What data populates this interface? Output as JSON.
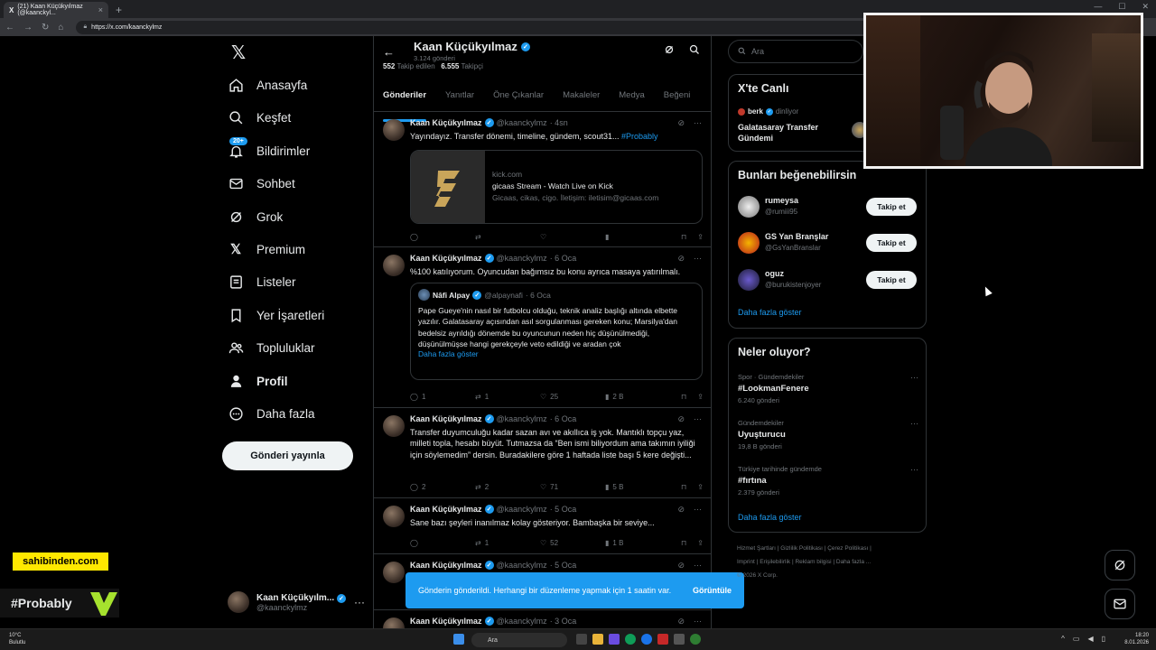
{
  "browser": {
    "tab_title": "(21) Kaan Küçükyılmaz (@kaanckyl...",
    "url": "https://x.com/kaanckylmz"
  },
  "nav": {
    "items": [
      {
        "label": "Anasayfa",
        "icon": "home-icon"
      },
      {
        "label": "Keşfet",
        "icon": "search-icon"
      },
      {
        "label": "Bildirimler",
        "icon": "bell-icon",
        "badge": "20+"
      },
      {
        "label": "Sohbet",
        "icon": "mail-icon"
      },
      {
        "label": "Grok",
        "icon": "grok-icon"
      },
      {
        "label": "Premium",
        "icon": "x-logo-icon"
      },
      {
        "label": "Listeler",
        "icon": "list-icon"
      },
      {
        "label": "Yer İşaretleri",
        "icon": "bookmark-icon"
      },
      {
        "label": "Topluluklar",
        "icon": "people-icon"
      },
      {
        "label": "Profil",
        "icon": "person-icon"
      },
      {
        "label": "Daha fazla",
        "icon": "more-circle-icon"
      }
    ],
    "post_button": "Gönderi yayınla",
    "account": {
      "name": "Kaan Küçükyılm...",
      "handle": "@kaanckylmz"
    }
  },
  "profile": {
    "name": "Kaan Küçükyılmaz",
    "posts_count": "3.124 gönderi",
    "following": "552",
    "following_label": "Takip edilen",
    "followers": "6.555",
    "followers_label": "Takipçi",
    "tabs": [
      "Gönderiler",
      "Yanıtlar",
      "Öne Çıkanlar",
      "Makaleler",
      "Medya",
      "Beğeni"
    ]
  },
  "tweets": [
    {
      "name": "Kaan Küçükyılmaz",
      "handle": "@kaanckylmz",
      "time": "· 4sn",
      "text": "Yayındayız. Transfer dönemi, timeline, gündem, scout31...",
      "hashtag": "#Probably",
      "card": {
        "domain": "kick.com",
        "title": "gicaas Stream - Watch Live on Kick",
        "desc": "Gicaas, cikas, cigo. İletişim: iletisim@gicaas.com"
      },
      "replies": "",
      "reposts": "",
      "likes": "",
      "views": ""
    },
    {
      "name": "Kaan Küçükyılmaz",
      "handle": "@kaanckylmz",
      "time": "· 6 Oca",
      "text": "%100 katılıyorum. Oyuncudan bağımsız bu konu ayrıca masaya yatırılmalı.",
      "quote": {
        "name": "Nâfi Alpay",
        "handle": "@alpaynafi",
        "time": "· 6 Oca",
        "text": "Pape Gueye'nin nasıl bir futbolcu olduğu, teknik analiz başlığı altında elbette yazılır. Galatasaray açısından asıl sorgulanması gereken konu; Marsilya'dan bedelsiz ayrıldığı dönemde bu oyuncunun neden hiç düşünülmediği, düşünülmüşse hangi gerekçeyle veto edildiği ve aradan çok",
        "more": "Daha fazla göster"
      },
      "replies": "1",
      "reposts": "1",
      "likes": "25",
      "views": "2 B"
    },
    {
      "name": "Kaan Küçükyılmaz",
      "handle": "@kaanckylmz",
      "time": "· 6 Oca",
      "text": "Transfer duyumculuğu kadar sazan avı ve akıllıca iş yok. Mantıklı topçu yaz, milleti topla, hesabı büyüt. Tutmazsa da “Ben ismi biliyordum ama takımın iyiliği için söylemedim” dersin. Buradakilere göre 1 haftada liste başı 5 kere değişti...",
      "replies": "2",
      "reposts": "2",
      "likes": "71",
      "views": "5 B"
    },
    {
      "name": "Kaan Küçükyılmaz",
      "handle": "@kaanckylmz",
      "time": "· 5 Oca",
      "text": "Sane bazı şeyleri inanılmaz kolay gösteriyor. Bambaşka bir seviye...",
      "replies": "",
      "reposts": "1",
      "likes": "52",
      "views": "1 B"
    },
    {
      "name": "Kaan Küçükyılmaz",
      "handle": "@kaanckylmz",
      "time": "· 5 Oca",
      "text": ""
    },
    {
      "name": "Kaan Küçükyılmaz",
      "handle": "@kaanckylmz",
      "time": "· 3 Oca",
      "text": ""
    }
  ],
  "toast": {
    "message": "Gönderin gönderildi. Herhangi bir düzenleme yapmak için 1 saatin var.",
    "action": "Görüntüle"
  },
  "right": {
    "search_placeholder": "Ara",
    "live": {
      "title": "X'te Canlı",
      "user": "berk",
      "status": "dinliyor",
      "space": "Galatasaray Transfer Gündemi"
    },
    "suggest": {
      "title": "Bunları beğenebilirsin",
      "users": [
        {
          "name": "rumeysa",
          "handle": "@rumiii95",
          "button": "Takip et"
        },
        {
          "name": "GS Yan Branşlar",
          "handle": "@GsYanBranslar",
          "button": "Takip et"
        },
        {
          "name": "oguz",
          "handle": "@burukistenjoyer",
          "button": "Takip et"
        }
      ],
      "more": "Daha fazla göster"
    },
    "trends": {
      "title": "Neler oluyor?",
      "items": [
        {
          "context": "Spor · Gündemdekiler",
          "topic": "#LookmanFenere",
          "posts": "6.240 gönderi"
        },
        {
          "context": "Gündemdekiler",
          "topic": "Uyuşturucu",
          "posts": "19,8 B gönderi"
        },
        {
          "context": "Türkiye tarihinde gündemde",
          "topic": "#fırtına",
          "posts": "2.379 gönderi"
        }
      ],
      "more": "Daha fazla göster"
    },
    "footer": [
      "Hizmet Şartları",
      "Gizlilik Politikası",
      "Çerez Politikası",
      "Imprint",
      "Erişilebilirlik",
      "Reklam bilgisi",
      "Daha fazla ...",
      "© 2026 X Corp."
    ]
  },
  "overlays": {
    "sahibinden": "sahibinden.com",
    "probably": "#Probably"
  },
  "taskbar": {
    "temp": "10°C",
    "weather": "Bulutlu",
    "search": "Ara",
    "time": "18:20",
    "date": "8.01.2026"
  },
  "colors": {
    "accent": "#1d9bf0",
    "background": "#000000",
    "border": "#2f3336",
    "muted": "#71767b"
  }
}
